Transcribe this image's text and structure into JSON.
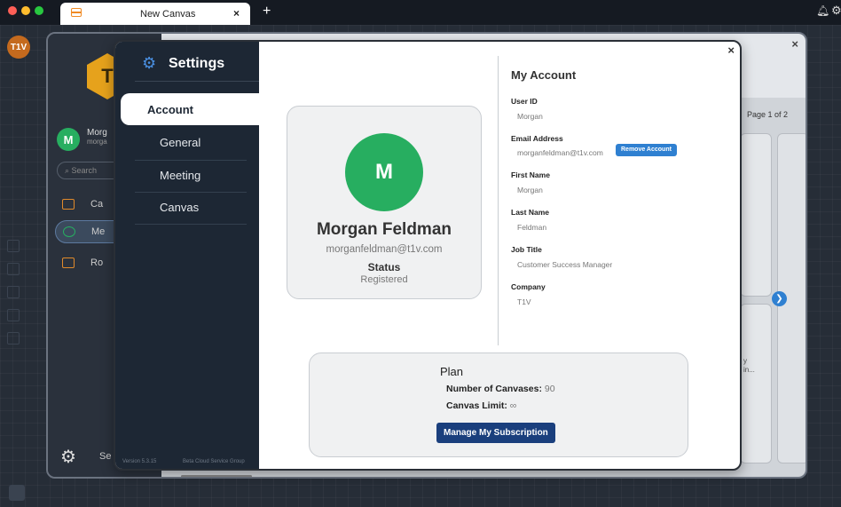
{
  "browser": {
    "tab_title": "New Canvas",
    "tab_close": "×",
    "new_tab": "+",
    "bell_icon": "bell-icon",
    "settings_icon": "gear-icon"
  },
  "background_app": {
    "logo": "T1V",
    "hex_letter": "T",
    "user_initial": "M",
    "user_name": "Morg",
    "user_sub": "morga",
    "search_placeholder": "Search",
    "nav": [
      {
        "label": "Ca",
        "icon": "canvas-icon"
      },
      {
        "label": "Me",
        "icon": "meeting-icon"
      },
      {
        "label": "Ro",
        "icon": "room-icon"
      }
    ],
    "settings_label": "Se",
    "close": "×",
    "page_indicator": "Page 1 of 2",
    "card_snippet_line1": "y",
    "card_snippet_line2": "in..."
  },
  "settings": {
    "title": "Settings",
    "nav": [
      {
        "label": "Account",
        "active": true
      },
      {
        "label": "General",
        "active": false
      },
      {
        "label": "Meeting",
        "active": false
      },
      {
        "label": "Canvas",
        "active": false
      }
    ],
    "version": "Version 5.3.15",
    "build": "Beta Cloud Service Group",
    "close": "×"
  },
  "profile": {
    "initial": "M",
    "name": "Morgan Feldman",
    "email": "morganfeldman@t1v.com",
    "status_label": "Status",
    "status": "Registered"
  },
  "account": {
    "title": "My Account",
    "fields": [
      {
        "label": "User ID",
        "value": "Morgan"
      },
      {
        "label": "Email Address",
        "value": "morganfeldman@t1v.com"
      },
      {
        "label": "First Name",
        "value": "Morgan"
      },
      {
        "label": "Last Name",
        "value": "Feldman"
      },
      {
        "label": "Job Title",
        "value": "Customer Success Manager"
      },
      {
        "label": "Company",
        "value": "T1V"
      }
    ],
    "remove_button": "Remove Account"
  },
  "plan": {
    "title": "Plan",
    "canvases_label": "Number of Canvases:",
    "canvases_value": "90",
    "limit_label": "Canvas Limit:",
    "limit_value": "∞",
    "manage_button": "Manage My Subscription"
  },
  "colors": {
    "accent": "#2f80d1",
    "sidebar": "#1d2734",
    "avatar": "#27ae60",
    "manage_button": "#1a3f7d"
  }
}
